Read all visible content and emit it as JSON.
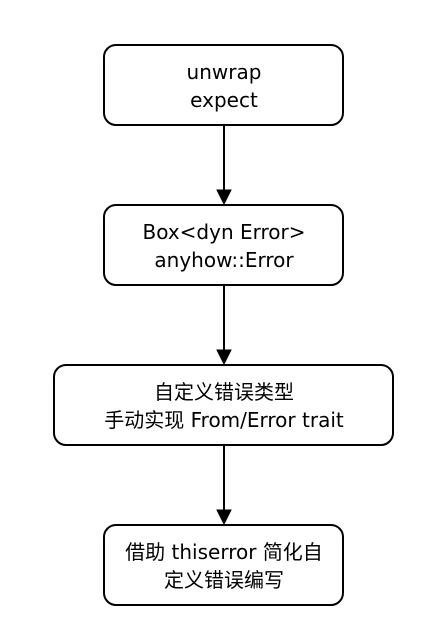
{
  "diagram": {
    "nodes": [
      {
        "id": "n1",
        "lines": [
          "unwrap",
          "expect"
        ]
      },
      {
        "id": "n2",
        "lines": [
          "Box<dyn Error>",
          "anyhow::Error"
        ]
      },
      {
        "id": "n3",
        "lines": [
          "自定义错误类型",
          "手动实现 From/Error trait"
        ]
      },
      {
        "id": "n4",
        "lines": [
          "借助 thiserror 简化自",
          "定义错误编写"
        ]
      }
    ],
    "edges": [
      {
        "from": "n1",
        "to": "n2"
      },
      {
        "from": "n2",
        "to": "n3"
      },
      {
        "from": "n3",
        "to": "n4"
      }
    ]
  }
}
